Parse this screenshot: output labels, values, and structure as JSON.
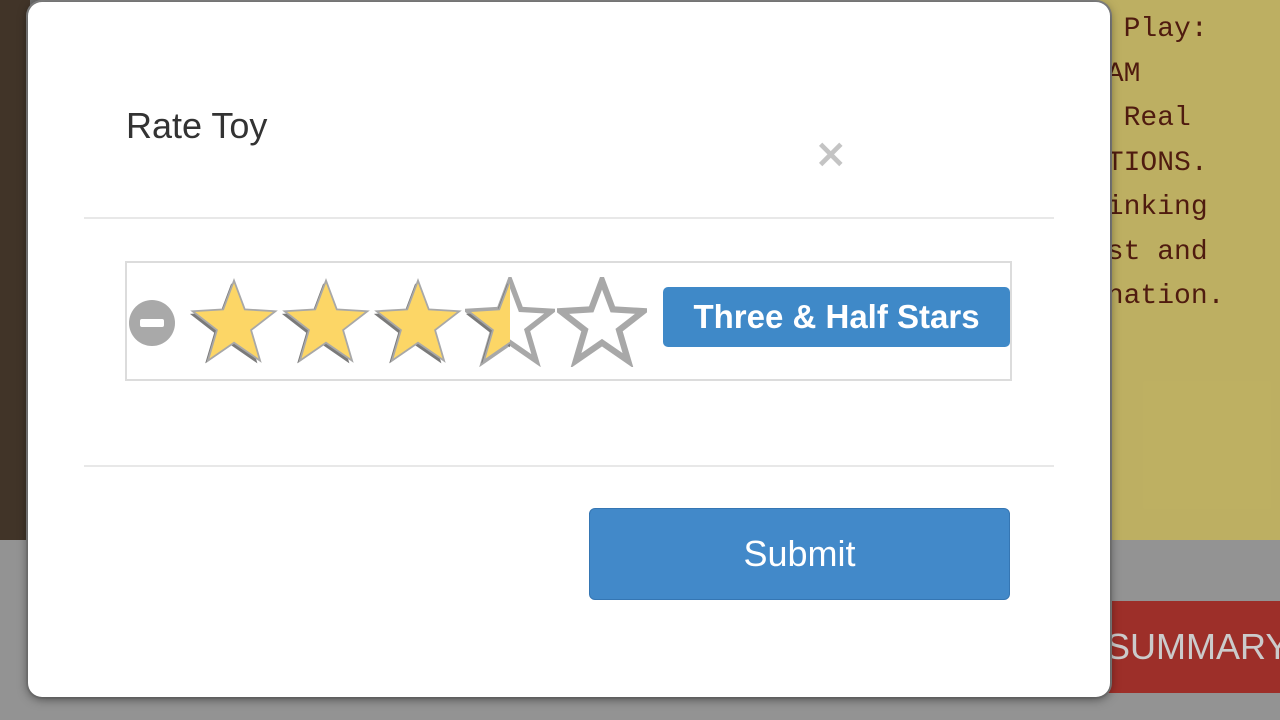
{
  "background": {
    "text_lines": [
      "n Play:",
      "EAM",
      "h Real",
      "CTIONS.",
      "hinking",
      "est and",
      "ination."
    ],
    "summary_label": "SUMMARY"
  },
  "modal": {
    "title": "Rate Toy",
    "close_label": "×"
  },
  "rating": {
    "value": 3.5,
    "max": 5,
    "badge_text": "Three & Half Stars",
    "star_icon": "star-icon",
    "clear_icon": "minus-circle-icon"
  },
  "footer": {
    "submit_label": "Submit"
  },
  "colors": {
    "star_fill": "#fcd666",
    "star_empty": "#ffffff",
    "star_outline": "#a8a8a8",
    "badge": "#3f89c8",
    "submit": "#4289c9",
    "summary": "#b3362f"
  }
}
